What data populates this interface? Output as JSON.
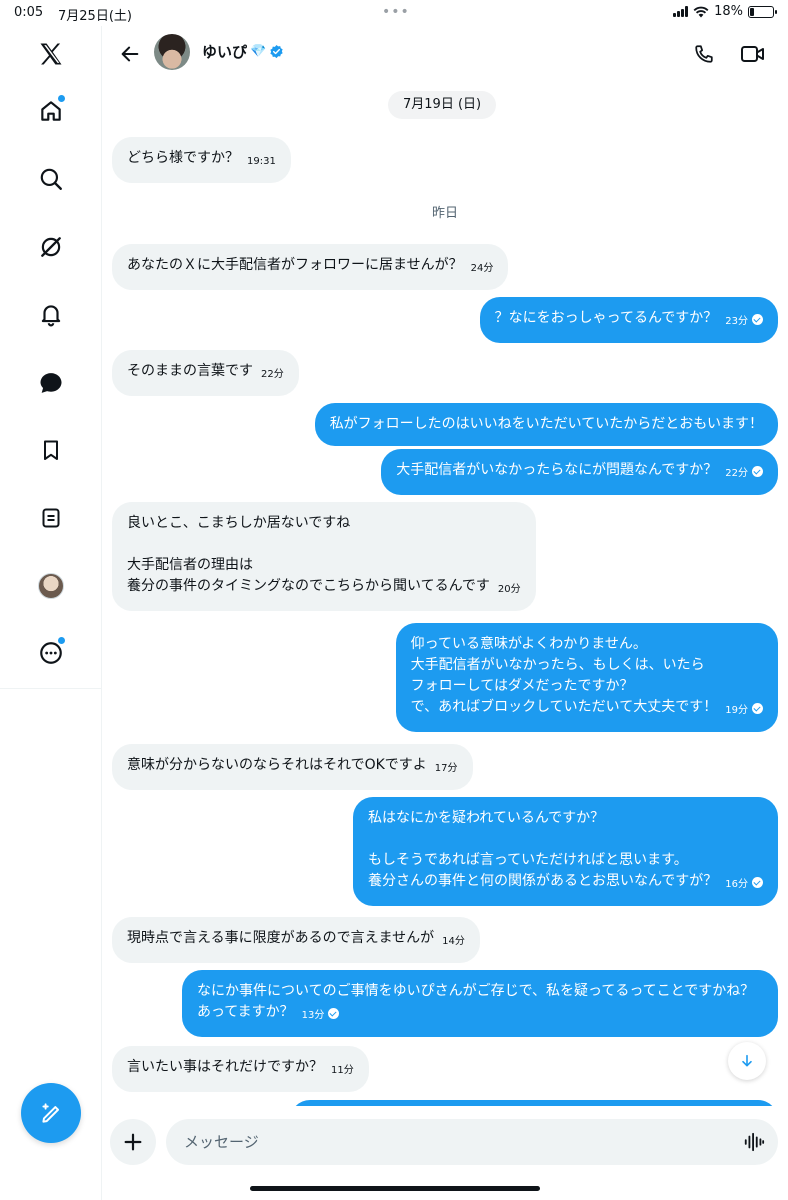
{
  "status_bar": {
    "time": "0:05",
    "date": "7月25日(土)",
    "battery": "18%"
  },
  "sidebar": {
    "items": [
      {
        "icon": "x-logo-icon"
      },
      {
        "icon": "home-icon",
        "badge": true
      },
      {
        "icon": "search-icon"
      },
      {
        "icon": "grok-icon"
      },
      {
        "icon": "bell-icon"
      },
      {
        "icon": "messages-icon"
      },
      {
        "icon": "bookmark-icon"
      },
      {
        "icon": "lists-icon"
      },
      {
        "icon": "profile-avatar"
      },
      {
        "icon": "more-icon",
        "badge": true
      }
    ],
    "compose_icon": "compose-icon"
  },
  "header": {
    "name": "ゆいぴ",
    "name_emoji": "💎",
    "verified": true
  },
  "chat": {
    "date_pill": "7月19日 (日)",
    "day_label": "昨日",
    "messages": [
      {
        "dir": "in",
        "text": "どちら様ですか？",
        "time": "19:31"
      },
      {
        "dir": "in",
        "text": "あなたのＸに大手配信者がフォロワーに居ませんが？",
        "time": "24分"
      },
      {
        "dir": "out",
        "text": "？なにをおっしゃってるんですか？",
        "time": "23分"
      },
      {
        "dir": "in",
        "text": "そのままの言葉です",
        "time": "22分"
      },
      {
        "dir": "out",
        "text": "私がフォローしたのはいいねをいただいていたからだとおもいます！",
        "time": ""
      },
      {
        "dir": "out",
        "text": "大手配信者がいなかったらなにが問題なんですか？",
        "time": "22分"
      },
      {
        "dir": "in",
        "text": "良いとこ、こまちしか居ないですね\n\n大手配信者の理由は\n養分の事件のタイミングなのでこちらから聞いてるんです",
        "time": "20分"
      },
      {
        "dir": "out",
        "text": "仰っている意味がよくわかりません。\n大手配信者がいなかったら、もしくは、いたら\nフォローしてはダメだったですか？\nで、あればブロックしていただいて大丈夫です！",
        "time": "19分"
      },
      {
        "dir": "in",
        "text": "意味が分からないのならそれはそれでOKですよ",
        "time": "17分"
      },
      {
        "dir": "out",
        "text": "私はなにかを疑われているんですか？\n\nもしそうであれば言っていただければと思います。\n養分さんの事件と何の関係があるとお思いなんですが？",
        "time": "16分"
      },
      {
        "dir": "in",
        "text": "現時点で言える事に限度があるので言えませんが",
        "time": "14分"
      },
      {
        "dir": "out",
        "text": "なにか事件についてのご事情をゆいぴさんがご存じで、私を疑ってるってことですかね？あってますか？",
        "time": "13分"
      },
      {
        "dir": "in",
        "text": "言いたい事はそれだけですか？",
        "time": "11分"
      }
    ]
  },
  "composer": {
    "placeholder": "メッセージ"
  },
  "colors": {
    "accent": "#1d9bf0",
    "bubble_in": "#eff3f4",
    "text": "#0f1419",
    "muted": "#536471"
  }
}
